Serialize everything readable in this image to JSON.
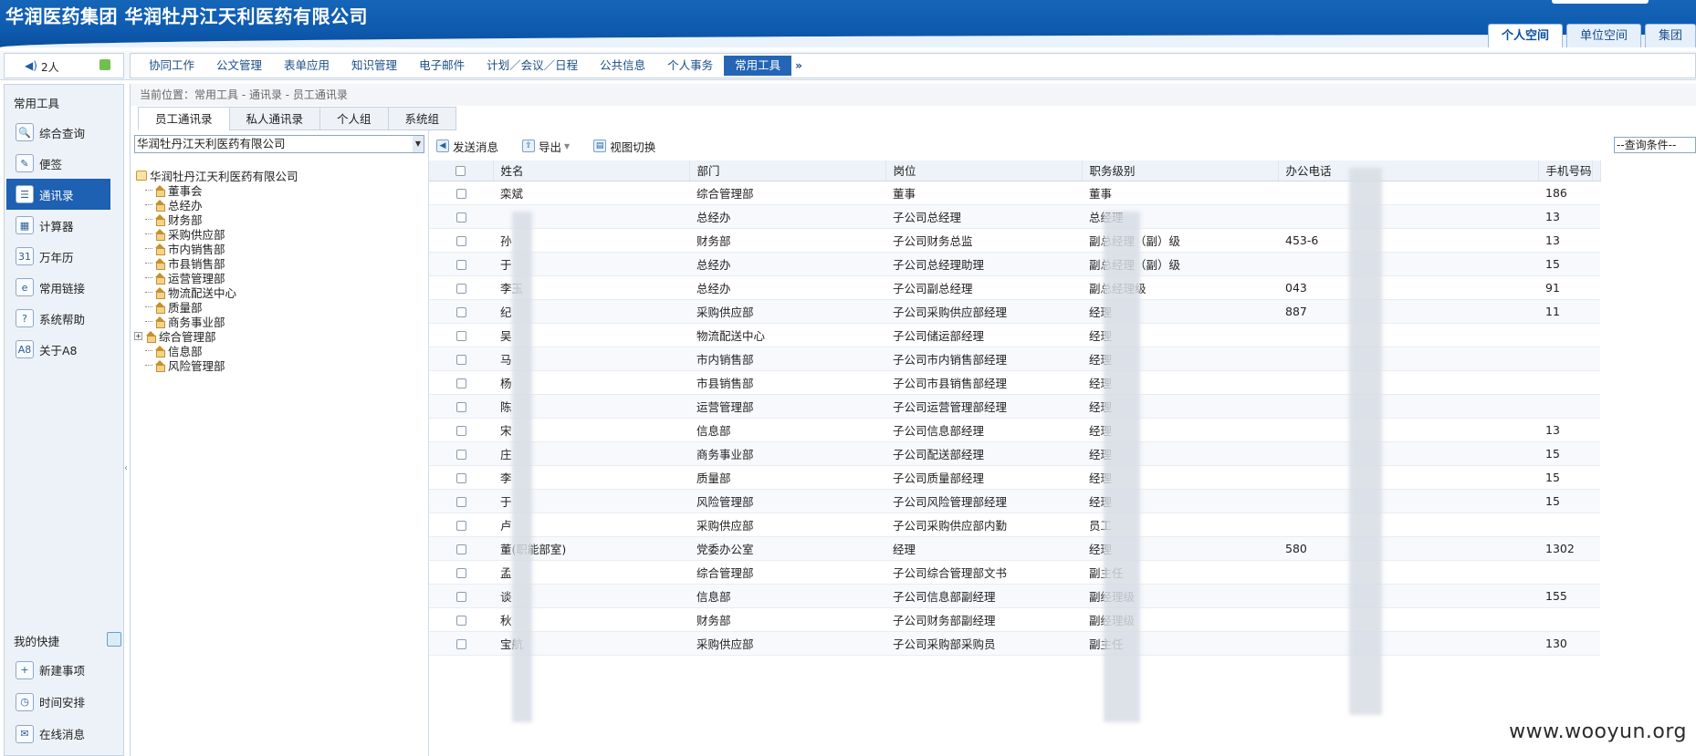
{
  "header": {
    "title": "华润医药集团 华润牡丹江天利医药有限公司",
    "space_tabs": [
      "个人空间",
      "单位空间",
      "集团"
    ]
  },
  "online": {
    "count": "2人"
  },
  "menu": {
    "items": [
      "协同工作",
      "公文管理",
      "表单应用",
      "知识管理",
      "电子邮件",
      "计划／会议／日程",
      "公共信息",
      "个人事务",
      "常用工具"
    ],
    "active": "常用工具",
    "more": "»"
  },
  "sidebar": {
    "title": "常用工具",
    "items": [
      {
        "label": "综合查询",
        "icon": "search-doc-icon",
        "glyph": "🔍"
      },
      {
        "label": "便签",
        "icon": "note-icon",
        "glyph": "✎"
      },
      {
        "label": "通讯录",
        "icon": "address-book-icon",
        "glyph": "☰"
      },
      {
        "label": "计算器",
        "icon": "calculator-icon",
        "glyph": "▦"
      },
      {
        "label": "万年历",
        "icon": "calendar-icon",
        "glyph": "31"
      },
      {
        "label": "常用链接",
        "icon": "link-icon",
        "glyph": "e"
      },
      {
        "label": "系统帮助",
        "icon": "help-icon",
        "glyph": "?"
      },
      {
        "label": "关于A8",
        "icon": "about-icon",
        "glyph": "A8"
      }
    ],
    "active": "通讯录",
    "quick_title": "我的快捷",
    "quick_items": [
      {
        "label": "新建事项",
        "icon": "new-item-icon",
        "glyph": "+"
      },
      {
        "label": "时间安排",
        "icon": "schedule-icon",
        "glyph": "◷"
      },
      {
        "label": "在线消息",
        "icon": "online-message-icon",
        "glyph": "✉"
      }
    ]
  },
  "breadcrumb": "当前位置：常用工具 - 通讯录 - 员工通讯录",
  "subtabs": [
    "员工通讯录",
    "私人通讯录",
    "个人组",
    "系统组"
  ],
  "org_select": "华润牡丹江天利医药有限公司",
  "tree": {
    "root": "华润牡丹江天利医药有限公司",
    "nodes": [
      "董事会",
      "总经办",
      "财务部",
      "采购供应部",
      "市内销售部",
      "市县销售部",
      "运营管理部",
      "物流配送中心",
      "质量部",
      "商务事业部",
      "综合管理部",
      "信息部",
      "风险管理部"
    ]
  },
  "toolbar": {
    "send_message": "发送消息",
    "export": "导出",
    "view_toggle": "视图切换",
    "query_placeholder": "--查询条件--"
  },
  "table": {
    "columns": [
      "姓名",
      "部门",
      "岗位",
      "职务级别",
      "办公电话",
      "手机号码"
    ],
    "rows": [
      [
        "栾斌",
        "综合管理部",
        "董事",
        "董事",
        "",
        "186"
      ],
      [
        "",
        "总经办",
        "子公司总经理",
        "总经理",
        "",
        "13"
      ],
      [
        "孙",
        "财务部",
        "子公司财务总监",
        "副总经理（副）级",
        "453-6",
        "13"
      ],
      [
        "于",
        "总经办",
        "子公司总经理助理",
        "副总经理（副）级",
        "",
        "15"
      ],
      [
        "李玉",
        "总经办",
        "子公司副总经理",
        "副总经理级",
        "043",
        "91"
      ],
      [
        "纪",
        "采购供应部",
        "子公司采购供应部经理",
        "经理",
        "887",
        "11"
      ],
      [
        "吴",
        "物流配送中心",
        "子公司储运部经理",
        "经理",
        "",
        ""
      ],
      [
        "马",
        "市内销售部",
        "子公司市内销售部经理",
        "经理",
        "",
        ""
      ],
      [
        "杨",
        "市县销售部",
        "子公司市县销售部经理",
        "经理",
        "",
        ""
      ],
      [
        "陈",
        "运营管理部",
        "子公司运营管理部经理",
        "经理",
        "",
        ""
      ],
      [
        "宋",
        "信息部",
        "子公司信息部经理",
        "经理",
        "",
        "13"
      ],
      [
        "庄",
        "商务事业部",
        "子公司配送部经理",
        "经理",
        "",
        "15"
      ],
      [
        "李",
        "质量部",
        "子公司质量部经理",
        "经理",
        "",
        "15"
      ],
      [
        "于",
        "风险管理部",
        "子公司风险管理部经理",
        "经理",
        "",
        "15"
      ],
      [
        "卢",
        "采购供应部",
        "子公司采购供应部内勤",
        "员工",
        "",
        ""
      ],
      [
        "董(职能部室)",
        "党委办公室",
        "经理",
        "经理",
        "580",
        "1302"
      ],
      [
        "孟",
        "综合管理部",
        "子公司综合管理部文书",
        "副主任",
        "",
        ""
      ],
      [
        "谈",
        "信息部",
        "子公司信息部副经理",
        "副经理级",
        "",
        "155"
      ],
      [
        "秋",
        "财务部",
        "子公司财务部副经理",
        "副经理级",
        "",
        ""
      ],
      [
        "宝航",
        "采购供应部",
        "子公司采购部采购员",
        "副主任",
        "",
        "130"
      ]
    ]
  },
  "watermark": "www.wooyun.org"
}
